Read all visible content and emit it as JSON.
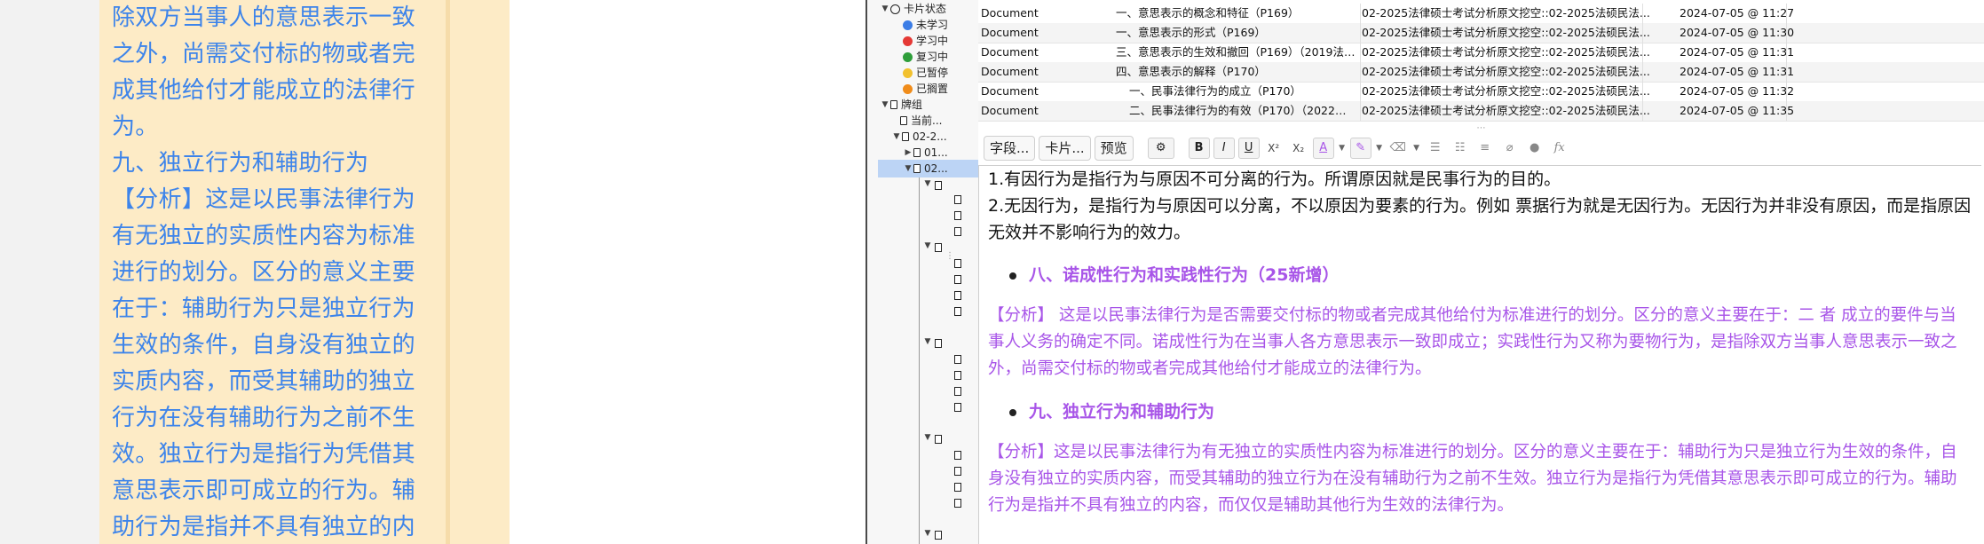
{
  "left_card": {
    "lines": [
      "除双方当事人的意思表示一致",
      "之外，尚需交付标的物或者完",
      "成其他给付才能成立的法律行",
      "为。",
      "九、独立行为和辅助行为",
      "【分析】这是以民事法律行为",
      "有无独立的实质性内容为标准",
      "进行的划分。区分的意义主要",
      "在于：辅助行为只是独立行为",
      "生效的条件，自身没有独立的",
      "实质内容，而受其辅助的独立",
      "行为在没有辅助行为之前不生",
      "效。独立行为是指行为凭借其",
      "意思表示即可成立的行为。辅",
      "助行为是指并不具有独立的内"
    ]
  },
  "sidebar": {
    "items": [
      {
        "label": "卡片状态",
        "icon": "circle-outline-icon"
      },
      {
        "label": "未学习",
        "icon": "blue-dot-icon",
        "color": "#3b7de6"
      },
      {
        "label": "学习中",
        "icon": "red-dot-icon",
        "color": "#e53935"
      },
      {
        "label": "复习中",
        "icon": "green-dot-icon",
        "color": "#2e9e3a"
      },
      {
        "label": "已暂停",
        "icon": "yellow-dot-icon",
        "color": "#f2c12e"
      },
      {
        "label": "已搁置",
        "icon": "orange-dot-icon",
        "color": "#f08c1a"
      },
      {
        "label": "牌组",
        "icon": "deck-icon"
      },
      {
        "label": "当前...",
        "icon": "current-deck-icon"
      },
      {
        "label": "02-2...",
        "icon": "deck-icon"
      },
      {
        "label": "01...",
        "icon": "deck-icon"
      },
      {
        "label": "02...",
        "icon": "deck-icon"
      }
    ]
  },
  "table": {
    "rows": [
      {
        "type": "Document",
        "sort_field": "一、意思表示的概念和特征（P169）",
        "deck": "02-2025法律硕士考试分析原文挖空::02-2025法硕民法...",
        "due": "2024-07-05 @ 11:27"
      },
      {
        "type": "Document",
        "sort_field": "一、意思表示的形式（P169）",
        "deck": "02-2025法律硕士考试分析原文挖空::02-2025法硕民法...",
        "due": "2024-07-05 @ 11:30"
      },
      {
        "type": "Document",
        "sort_field": "三、意思表示的生效和撤回（P169）（2019法/...",
        "deck": "02-2025法律硕士考试分析原文挖空::02-2025法硕民法...",
        "due": "2024-07-05 @ 11:31"
      },
      {
        "type": "Document",
        "sort_field": "四、意思表示的解释（P170）",
        "deck": "02-2025法律硕士考试分析原文挖空::02-2025法硕民法...",
        "due": "2024-07-05 @ 11:31"
      },
      {
        "type": "Document",
        "sort_field": "一、民事法律行为的成立（P170）",
        "deck": "02-2025法律硕士考试分析原文挖空::02-2025法硕民法...",
        "due": "2024-07-05 @ 11:32"
      },
      {
        "type": "Document",
        "sort_field": "二、民事法律行为的有效（P170）（2022法/...",
        "deck": "02-2025法律硕士考试分析原文挖空::02-2025法硕民法...",
        "due": "2024-07-05 @ 11:35"
      }
    ]
  },
  "toolbar": {
    "fields_label": "字段...",
    "cards_label": "卡片...",
    "preview_label": "预览",
    "bold": "B",
    "italic": "I",
    "underline": "U",
    "superscript": "X²",
    "subscript": "X₂",
    "font_color": "A",
    "mathjax": "fx"
  },
  "editor": {
    "para1": "1.有因行为是指行为与原因不可分离的行为。所谓原因就是民事行为的目的。",
    "para2": "2.无因行为，是指行为与原因可以分离，不以原因为要素的行为。例如 票据行为就是无因行为。无因行为并非没有原因，而是指原因无效并不影响行为的效力。",
    "heading8": "八、诺成性行为和实践性行为（25新增）",
    "analysis8": "【分析】 这是以民事法律行为是否需要交付标的物或者完成其他给付为标准进行的划分。区分的意义主要在于：二 者 成立的要件与当事人义务的确定不同。诺成性行为在当事人各方意思表示一致即成立；实践性行为又称为要物行为，是指除双方当事人意思表示一致之外，尚需交付标的物或者完成其他给付才能成立的法律行为。",
    "heading9": "九、独立行为和辅助行为",
    "analysis9": "【分析】这是以民事法律行为有无独立的实质性内容为标准进行的划分。区分的意义主要在于：辅助行为只是独立行为生效的条件，自身没有独立的实质内容，而受其辅助的独立行为在没有辅助行为之前不生效。独立行为是指行为凭借其意思表示即可成立的行为。辅助行为是指并不具有独立的内容，而仅仅是辅助其他行为生效的法律行为。"
  },
  "colors": {
    "card_bg": "#fdebc6",
    "card_text": "#3d84ea",
    "analysis_purple": "#a855e8",
    "selected_row": "#bcd4f5"
  }
}
